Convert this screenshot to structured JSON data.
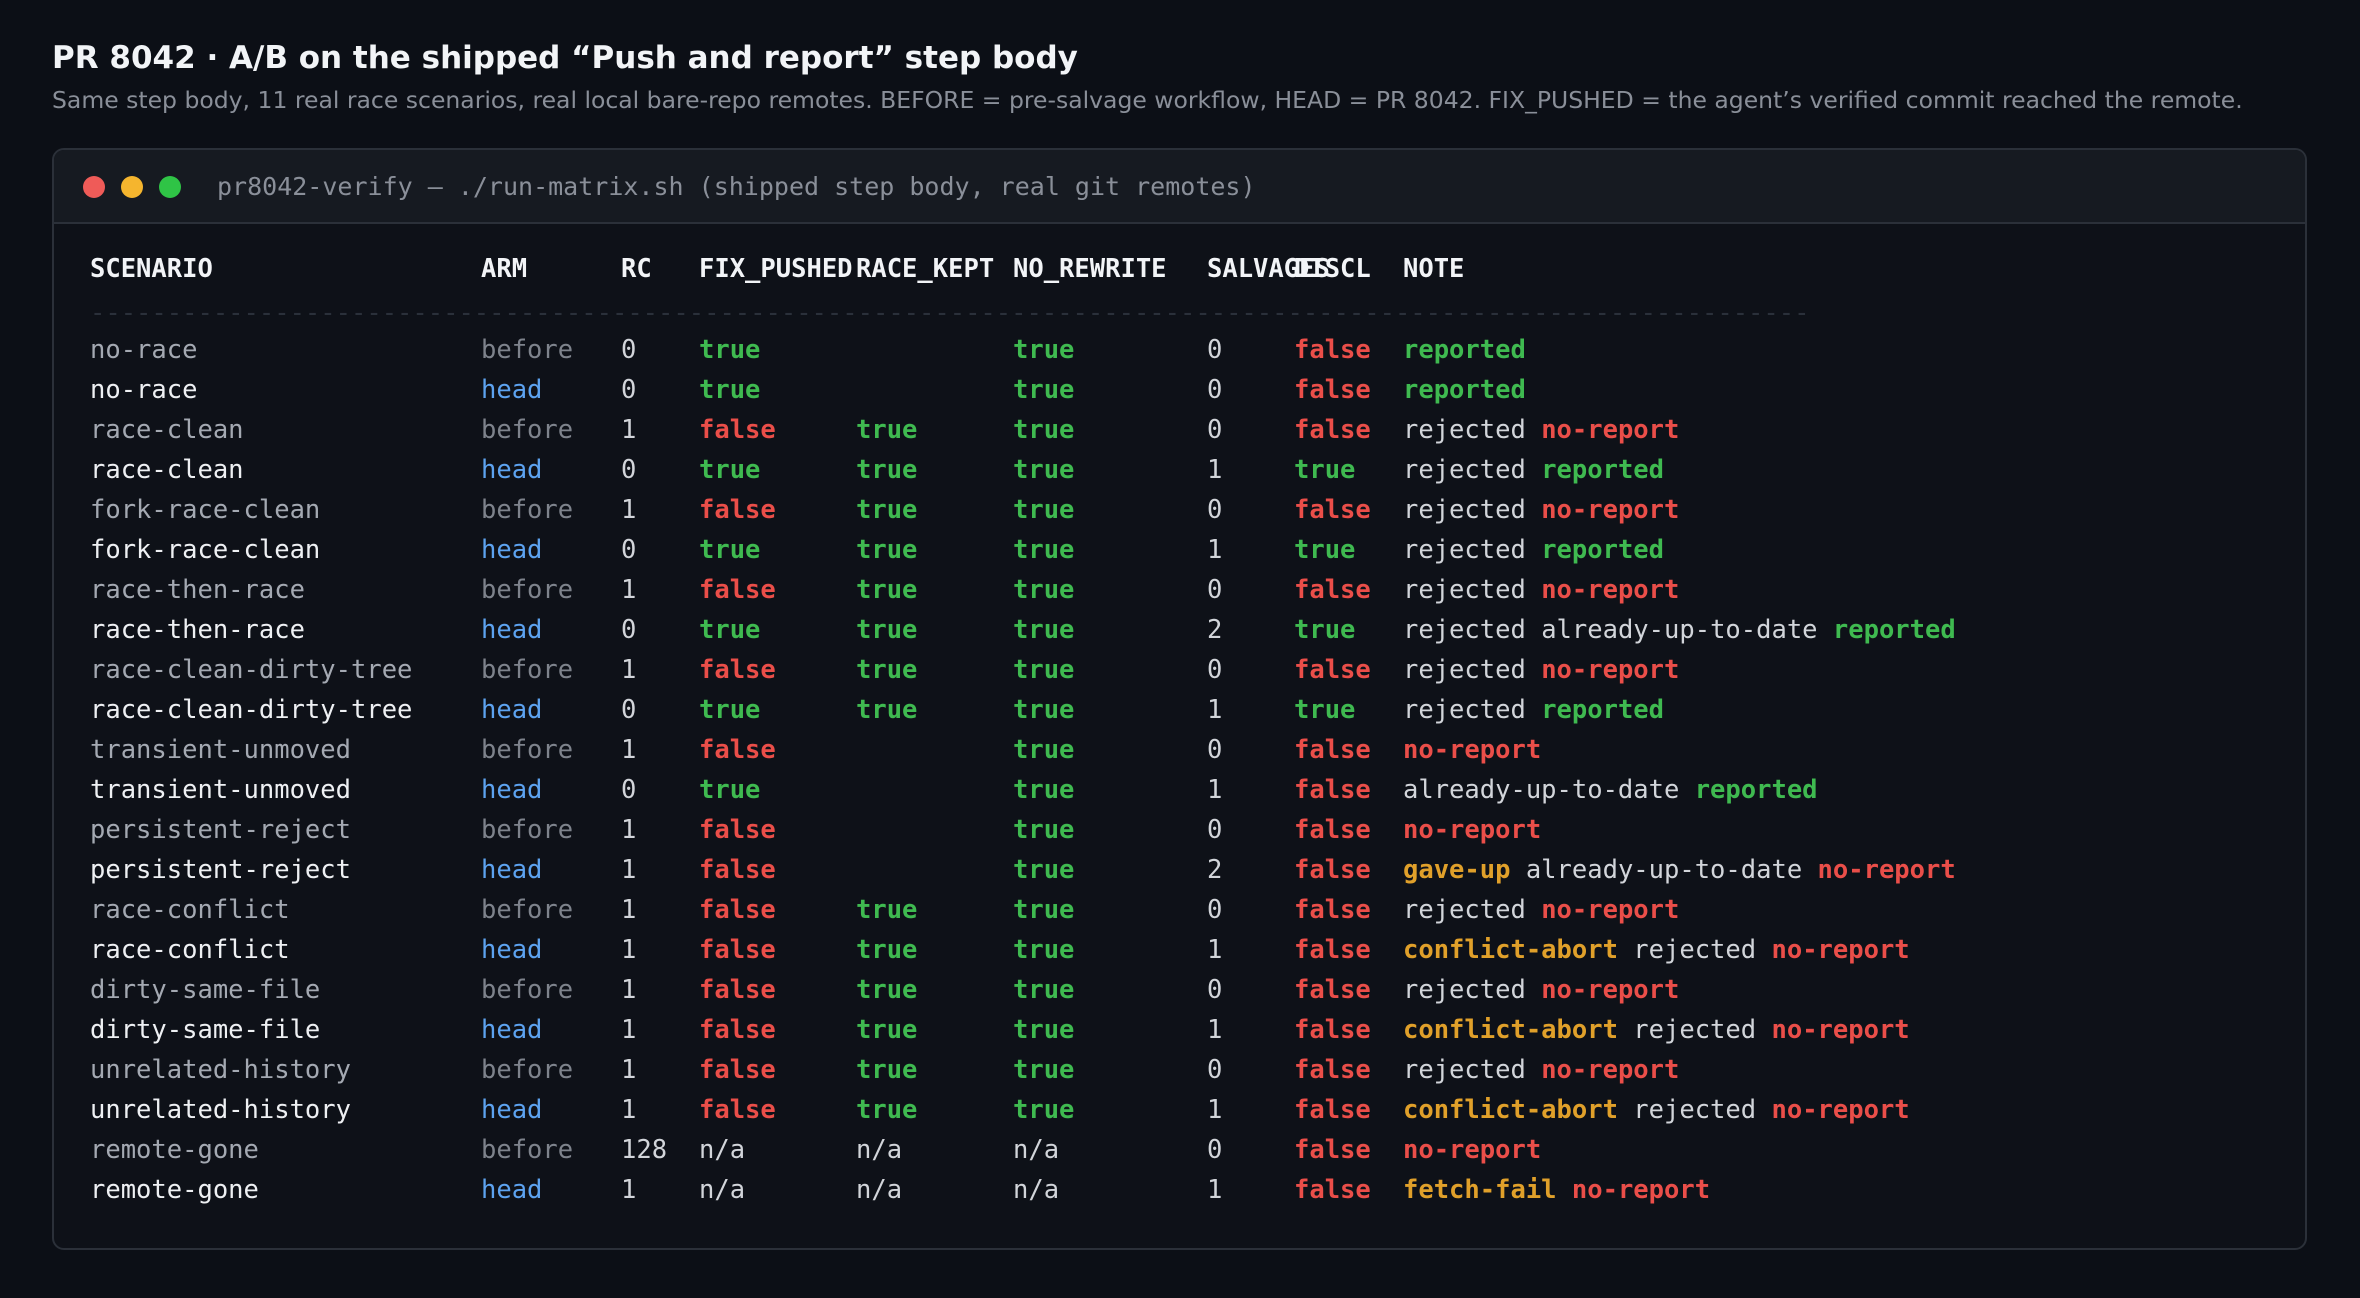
{
  "page": {
    "title": "PR 8042 · A/B on the shipped “Push and report” step body",
    "subtitle": "Same step body, 11 real race scenarios, real local bare-repo remotes. BEFORE = pre-salvage workflow, HEAD = PR 8042. FIX_PUSHED = the agent’s verified commit reached the remote."
  },
  "window": {
    "title": "pr8042-verify — ./run-matrix.sh (shipped step body, real git remotes)",
    "traffic_lights": [
      "close-icon",
      "minimize-icon",
      "maximize-icon"
    ],
    "colors": {
      "close": "#ef5b58",
      "minimize": "#f5b52e",
      "maximize": "#2fc446"
    }
  },
  "table": {
    "headers": {
      "scenario": "SCENARIO",
      "arm": "ARM",
      "rc": "RC",
      "fix_pushed": "FIX_PUSHED",
      "race_kept": "RACE_KEPT",
      "no_rewrite": "NO_REWRITE",
      "salvages": "SALVAGES",
      "discl": "DISCL",
      "note": "NOTE"
    },
    "separator": "----------------------------------------------------------------------------------------------------------------",
    "rows": [
      {
        "scenario": "no-race",
        "arm": "before",
        "rc": "0",
        "fix_pushed": "true",
        "race_kept": "",
        "no_rewrite": "true",
        "salvages": "0",
        "discl": "false",
        "note": [
          {
            "t": "reported",
            "s": "good"
          }
        ]
      },
      {
        "scenario": "no-race",
        "arm": "head",
        "rc": "0",
        "fix_pushed": "true",
        "race_kept": "",
        "no_rewrite": "true",
        "salvages": "0",
        "discl": "false",
        "note": [
          {
            "t": "reported",
            "s": "good"
          }
        ]
      },
      {
        "scenario": "race-clean",
        "arm": "before",
        "rc": "1",
        "fix_pushed": "false",
        "race_kept": "true",
        "no_rewrite": "true",
        "salvages": "0",
        "discl": "false",
        "note": [
          {
            "t": "rejected",
            "s": "plain"
          },
          {
            "t": "no-report",
            "s": "bad"
          }
        ]
      },
      {
        "scenario": "race-clean",
        "arm": "head",
        "rc": "0",
        "fix_pushed": "true",
        "race_kept": "true",
        "no_rewrite": "true",
        "salvages": "1",
        "discl": "true",
        "note": [
          {
            "t": "rejected",
            "s": "plain"
          },
          {
            "t": "reported",
            "s": "good"
          }
        ]
      },
      {
        "scenario": "fork-race-clean",
        "arm": "before",
        "rc": "1",
        "fix_pushed": "false",
        "race_kept": "true",
        "no_rewrite": "true",
        "salvages": "0",
        "discl": "false",
        "note": [
          {
            "t": "rejected",
            "s": "plain"
          },
          {
            "t": "no-report",
            "s": "bad"
          }
        ]
      },
      {
        "scenario": "fork-race-clean",
        "arm": "head",
        "rc": "0",
        "fix_pushed": "true",
        "race_kept": "true",
        "no_rewrite": "true",
        "salvages": "1",
        "discl": "true",
        "note": [
          {
            "t": "rejected",
            "s": "plain"
          },
          {
            "t": "reported",
            "s": "good"
          }
        ]
      },
      {
        "scenario": "race-then-race",
        "arm": "before",
        "rc": "1",
        "fix_pushed": "false",
        "race_kept": "true",
        "no_rewrite": "true",
        "salvages": "0",
        "discl": "false",
        "note": [
          {
            "t": "rejected",
            "s": "plain"
          },
          {
            "t": "no-report",
            "s": "bad"
          }
        ]
      },
      {
        "scenario": "race-then-race",
        "arm": "head",
        "rc": "0",
        "fix_pushed": "true",
        "race_kept": "true",
        "no_rewrite": "true",
        "salvages": "2",
        "discl": "true",
        "note": [
          {
            "t": "rejected",
            "s": "plain"
          },
          {
            "t": "already-up-to-date",
            "s": "plain"
          },
          {
            "t": "reported",
            "s": "good"
          }
        ]
      },
      {
        "scenario": "race-clean-dirty-tree",
        "arm": "before",
        "rc": "1",
        "fix_pushed": "false",
        "race_kept": "true",
        "no_rewrite": "true",
        "salvages": "0",
        "discl": "false",
        "note": [
          {
            "t": "rejected",
            "s": "plain"
          },
          {
            "t": "no-report",
            "s": "bad"
          }
        ]
      },
      {
        "scenario": "race-clean-dirty-tree",
        "arm": "head",
        "rc": "0",
        "fix_pushed": "true",
        "race_kept": "true",
        "no_rewrite": "true",
        "salvages": "1",
        "discl": "true",
        "note": [
          {
            "t": "rejected",
            "s": "plain"
          },
          {
            "t": "reported",
            "s": "good"
          }
        ]
      },
      {
        "scenario": "transient-unmoved",
        "arm": "before",
        "rc": "1",
        "fix_pushed": "false",
        "race_kept": "",
        "no_rewrite": "true",
        "salvages": "0",
        "discl": "false",
        "note": [
          {
            "t": "no-report",
            "s": "bad"
          }
        ]
      },
      {
        "scenario": "transient-unmoved",
        "arm": "head",
        "rc": "0",
        "fix_pushed": "true",
        "race_kept": "",
        "no_rewrite": "true",
        "salvages": "1",
        "discl": "false",
        "note": [
          {
            "t": "already-up-to-date",
            "s": "plain"
          },
          {
            "t": "reported",
            "s": "good"
          }
        ]
      },
      {
        "scenario": "persistent-reject",
        "arm": "before",
        "rc": "1",
        "fix_pushed": "false",
        "race_kept": "",
        "no_rewrite": "true",
        "salvages": "0",
        "discl": "false",
        "note": [
          {
            "t": "no-report",
            "s": "bad"
          }
        ]
      },
      {
        "scenario": "persistent-reject",
        "arm": "head",
        "rc": "1",
        "fix_pushed": "false",
        "race_kept": "",
        "no_rewrite": "true",
        "salvages": "2",
        "discl": "false",
        "note": [
          {
            "t": "gave-up",
            "s": "warn"
          },
          {
            "t": "already-up-to-date",
            "s": "plain"
          },
          {
            "t": "no-report",
            "s": "bad"
          }
        ]
      },
      {
        "scenario": "race-conflict",
        "arm": "before",
        "rc": "1",
        "fix_pushed": "false",
        "race_kept": "true",
        "no_rewrite": "true",
        "salvages": "0",
        "discl": "false",
        "note": [
          {
            "t": "rejected",
            "s": "plain"
          },
          {
            "t": "no-report",
            "s": "bad"
          }
        ]
      },
      {
        "scenario": "race-conflict",
        "arm": "head",
        "rc": "1",
        "fix_pushed": "false",
        "race_kept": "true",
        "no_rewrite": "true",
        "salvages": "1",
        "discl": "false",
        "note": [
          {
            "t": "conflict-abort",
            "s": "warn"
          },
          {
            "t": "rejected",
            "s": "plain"
          },
          {
            "t": "no-report",
            "s": "bad"
          }
        ]
      },
      {
        "scenario": "dirty-same-file",
        "arm": "before",
        "rc": "1",
        "fix_pushed": "false",
        "race_kept": "true",
        "no_rewrite": "true",
        "salvages": "0",
        "discl": "false",
        "note": [
          {
            "t": "rejected",
            "s": "plain"
          },
          {
            "t": "no-report",
            "s": "bad"
          }
        ]
      },
      {
        "scenario": "dirty-same-file",
        "arm": "head",
        "rc": "1",
        "fix_pushed": "false",
        "race_kept": "true",
        "no_rewrite": "true",
        "salvages": "1",
        "discl": "false",
        "note": [
          {
            "t": "conflict-abort",
            "s": "warn"
          },
          {
            "t": "rejected",
            "s": "plain"
          },
          {
            "t": "no-report",
            "s": "bad"
          }
        ]
      },
      {
        "scenario": "unrelated-history",
        "arm": "before",
        "rc": "1",
        "fix_pushed": "false",
        "race_kept": "true",
        "no_rewrite": "true",
        "salvages": "0",
        "discl": "false",
        "note": [
          {
            "t": "rejected",
            "s": "plain"
          },
          {
            "t": "no-report",
            "s": "bad"
          }
        ]
      },
      {
        "scenario": "unrelated-history",
        "arm": "head",
        "rc": "1",
        "fix_pushed": "false",
        "race_kept": "true",
        "no_rewrite": "true",
        "salvages": "1",
        "discl": "false",
        "note": [
          {
            "t": "conflict-abort",
            "s": "warn"
          },
          {
            "t": "rejected",
            "s": "plain"
          },
          {
            "t": "no-report",
            "s": "bad"
          }
        ]
      },
      {
        "scenario": "remote-gone",
        "arm": "before",
        "rc": "128",
        "fix_pushed": "n/a",
        "race_kept": "n/a",
        "no_rewrite": "n/a",
        "salvages": "0",
        "discl": "false",
        "note": [
          {
            "t": "no-report",
            "s": "bad"
          }
        ]
      },
      {
        "scenario": "remote-gone",
        "arm": "head",
        "rc": "1",
        "fix_pushed": "n/a",
        "race_kept": "n/a",
        "no_rewrite": "n/a",
        "salvages": "1",
        "discl": "false",
        "note": [
          {
            "t": "fetch-fail",
            "s": "warn"
          },
          {
            "t": "no-report",
            "s": "bad"
          }
        ]
      }
    ]
  }
}
